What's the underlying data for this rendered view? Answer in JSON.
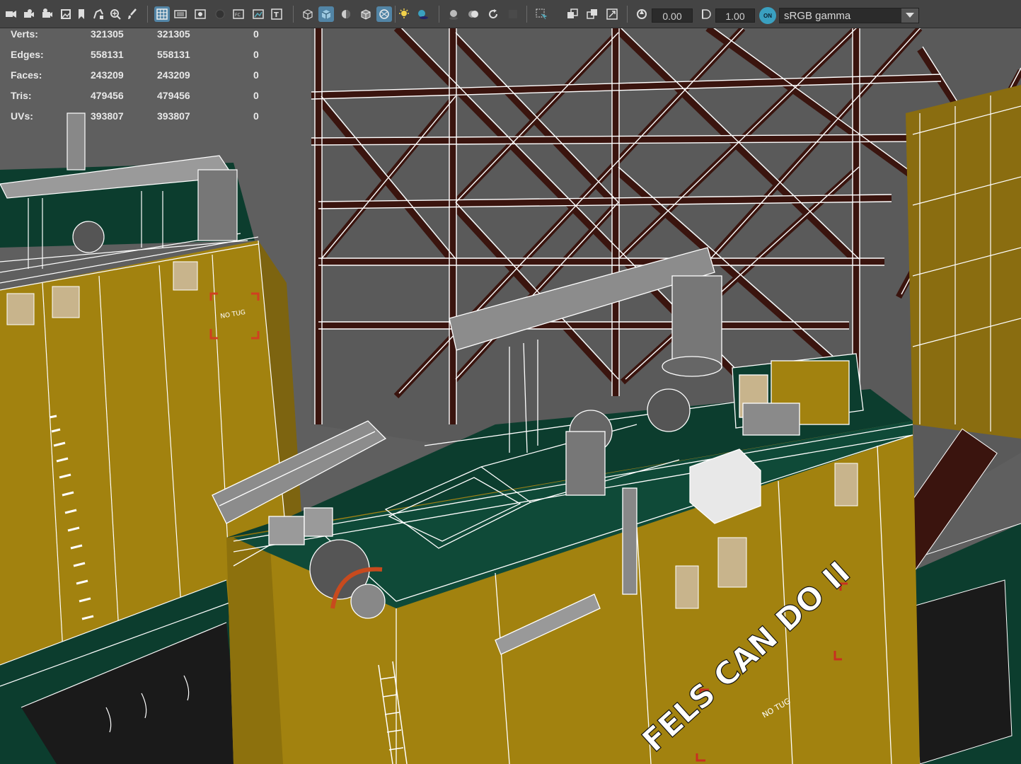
{
  "toolbar": {
    "icons": [
      "camera-select-icon",
      "camera-attributes-icon",
      "bookmark-icon",
      "image-plane-icon",
      "grease-pencil-icon",
      "2d-pan-zoom-icon",
      "grid-icon",
      "film-gate-icon",
      "resolution-gate-icon",
      "gate-mask-icon",
      "field-chart-icon",
      "safe-action-icon",
      "safe-title-icon",
      "wireframe-icon",
      "smooth-shade-all-icon",
      "use-default-material-icon",
      "wireframe-on-shaded-icon",
      "xray-icon",
      "use-all-lights-icon",
      "shadows-icon",
      "screen-space-ao-icon",
      "motion-blur-icon",
      "anti-aliasing-icon",
      "depth-of-field-icon",
      "isolate-select-icon",
      "xray-active-components-icon",
      "xray-joints-icon",
      "textured-icon",
      "exposure-icon",
      "gamma-icon",
      "color-management-icon"
    ],
    "exposure_value": "0.00",
    "gamma_value": "1.00",
    "color_mgmt_toggle": "ON",
    "color_space": "sRGB gamma"
  },
  "hud": {
    "rows": [
      {
        "label": "Verts:",
        "total": "321305",
        "selected": "321305",
        "components": "0"
      },
      {
        "label": "Edges:",
        "total": "558131",
        "selected": "558131",
        "components": "0"
      },
      {
        "label": "Faces:",
        "total": "243209",
        "selected": "243209",
        "components": "0"
      },
      {
        "label": "Tris:",
        "total": "479456",
        "selected": "479456",
        "components": "0"
      },
      {
        "label": "UVs:",
        "total": "393807",
        "selected": "393807",
        "components": "0"
      }
    ]
  },
  "scene": {
    "vessel_name_text": "FELS CAN DO II",
    "deck_sign_text_left": "NO TUG",
    "deck_sign_text_right": "NO TUG",
    "colors": {
      "viewport_bg": "#5f5f5f",
      "hull_yellow": "#a2820f",
      "deck_green": "#0c3d2e",
      "wire": "#ffffff",
      "truss_fill": "#3a140e",
      "mark_red": "#c83020"
    }
  }
}
